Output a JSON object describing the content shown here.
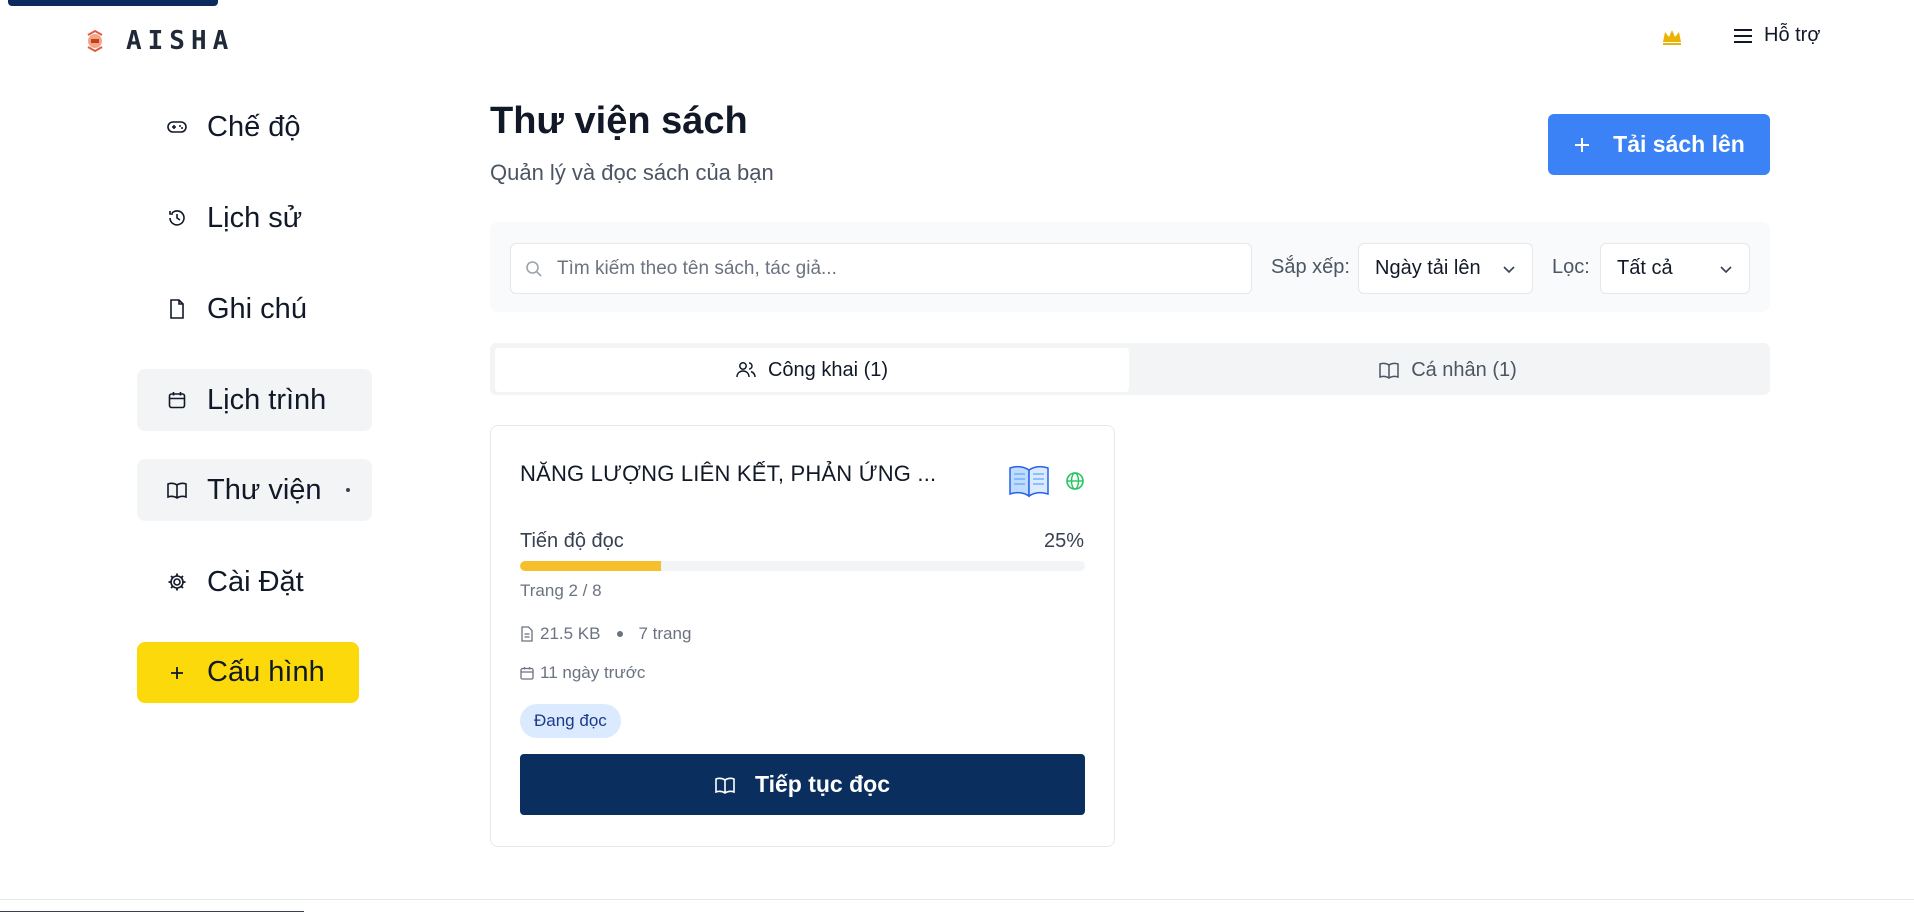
{
  "header": {
    "logo_text": "AISHA",
    "support_label": "Hỗ trợ"
  },
  "sidebar": {
    "items": [
      {
        "label": "Chế độ",
        "icon": "gamepad-icon"
      },
      {
        "label": "Lịch sử",
        "icon": "history-icon"
      },
      {
        "label": "Ghi chú",
        "icon": "file-icon"
      },
      {
        "label": "Lịch trình",
        "icon": "calendar-icon"
      },
      {
        "label": "Thư viện",
        "icon": "book-open-icon"
      },
      {
        "label": "Cài Đặt",
        "icon": "gear-icon"
      }
    ],
    "config_label": "Cấu hình"
  },
  "main": {
    "title": "Thư viện sách",
    "subtitle": "Quản lý và đọc sách của bạn",
    "upload_label": "Tải sách lên"
  },
  "toolbar": {
    "search_placeholder": "Tìm kiếm theo tên sách, tác giả...",
    "sort_label": "Sắp xếp:",
    "sort_value": "Ngày tải lên",
    "filter_label": "Lọc:",
    "filter_value": "Tất cả"
  },
  "tabs": [
    {
      "label": "Công khai (1)",
      "active": true
    },
    {
      "label": "Cá nhân (1)",
      "active": false
    }
  ],
  "book": {
    "title": "NĂNG LƯỢNG LIÊN KẾT, PHẢN ỨNG ...",
    "progress_label": "Tiến độ đọc",
    "progress_percent": 25,
    "progress_text": "25%",
    "page_info": "Trang 2 / 8",
    "size": "21.5 KB",
    "pages": "7 trang",
    "uploaded": "11 ngày trước",
    "status": "Đang đọc",
    "continue_label": "Tiếp tục đọc"
  },
  "colors": {
    "primary_blue": "#3b82f6",
    "navy": "#0a2f5f",
    "config_yellow": "#fcd90a",
    "progress_yellow": "#f5c02c",
    "badge_bg": "#dbeafe"
  }
}
